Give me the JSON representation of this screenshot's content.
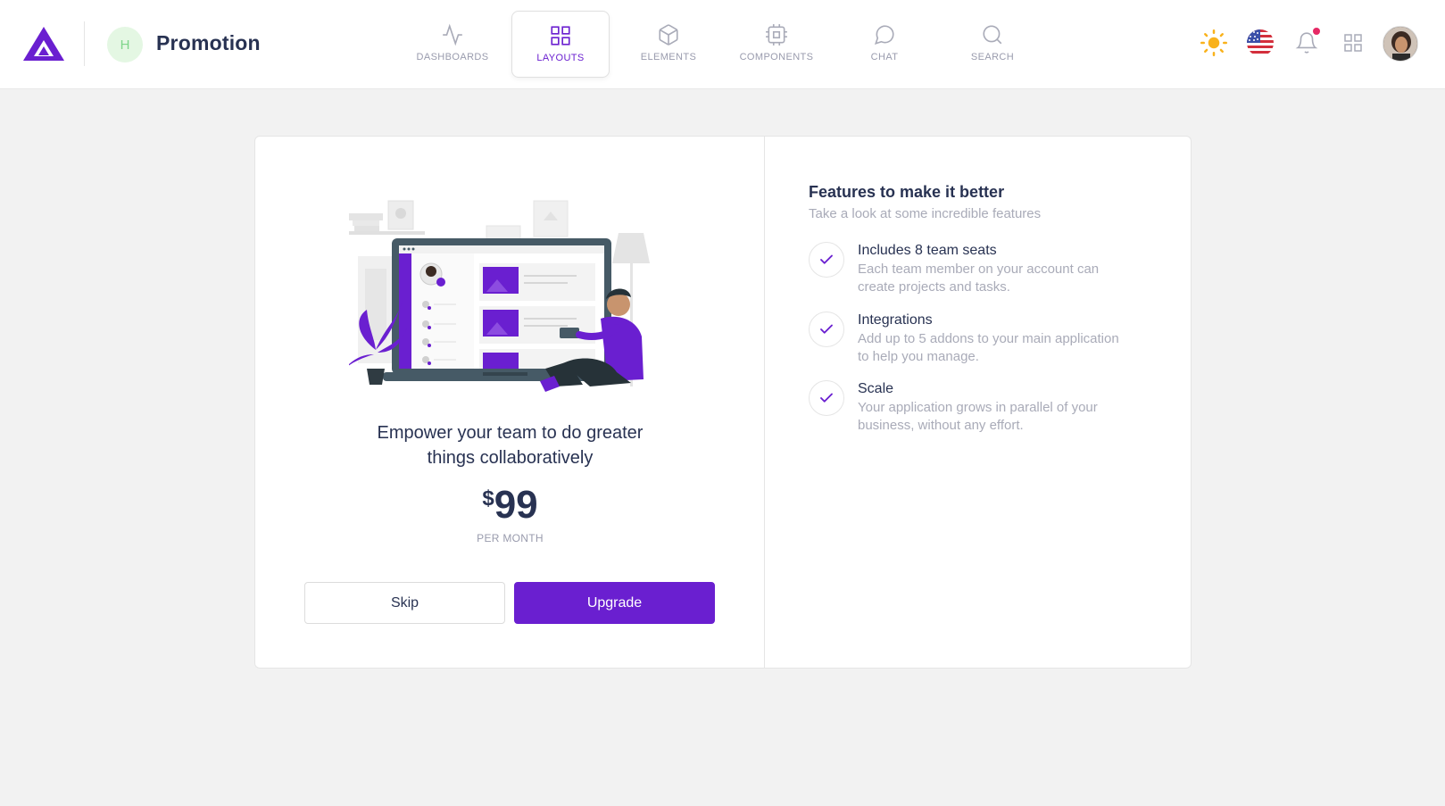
{
  "header": {
    "page_initial": "H",
    "page_title": "Promotion",
    "nav": [
      {
        "label": "DASHBOARDS",
        "icon": "activity-icon"
      },
      {
        "label": "LAYOUTS",
        "icon": "grid-icon",
        "active": true
      },
      {
        "label": "ELEMENTS",
        "icon": "box-icon"
      },
      {
        "label": "COMPONENTS",
        "icon": "cpu-icon"
      },
      {
        "label": "CHAT",
        "icon": "message-circle-icon"
      },
      {
        "label": "SEARCH",
        "icon": "search-icon"
      }
    ],
    "right_icons": [
      "sun-icon",
      "us-flag-icon",
      "bell-icon",
      "apps-grid-icon",
      "user-avatar"
    ]
  },
  "colors": {
    "accent": "#6a1fd0",
    "text": "#283252",
    "muted": "#a9abb8",
    "notification": "#e62965",
    "sun": "#f9b21c"
  },
  "promo": {
    "heading_line1": "Empower your team to do greater",
    "heading_line2": "things collaboratively",
    "currency": "$",
    "amount": "99",
    "period": "PER MONTH",
    "skip_label": "Skip",
    "upgrade_label": "Upgrade"
  },
  "features": {
    "title": "Features to make it better",
    "subtitle": "Take a look at some incredible features",
    "items": [
      {
        "name": "Includes 8 team seats",
        "desc": "Each team member on your account can create projects and tasks."
      },
      {
        "name": "Integrations",
        "desc": "Add up to 5 addons to your main application to help you manage."
      },
      {
        "name": "Scale",
        "desc": "Your application grows in parallel of your business, without any effort."
      }
    ]
  }
}
